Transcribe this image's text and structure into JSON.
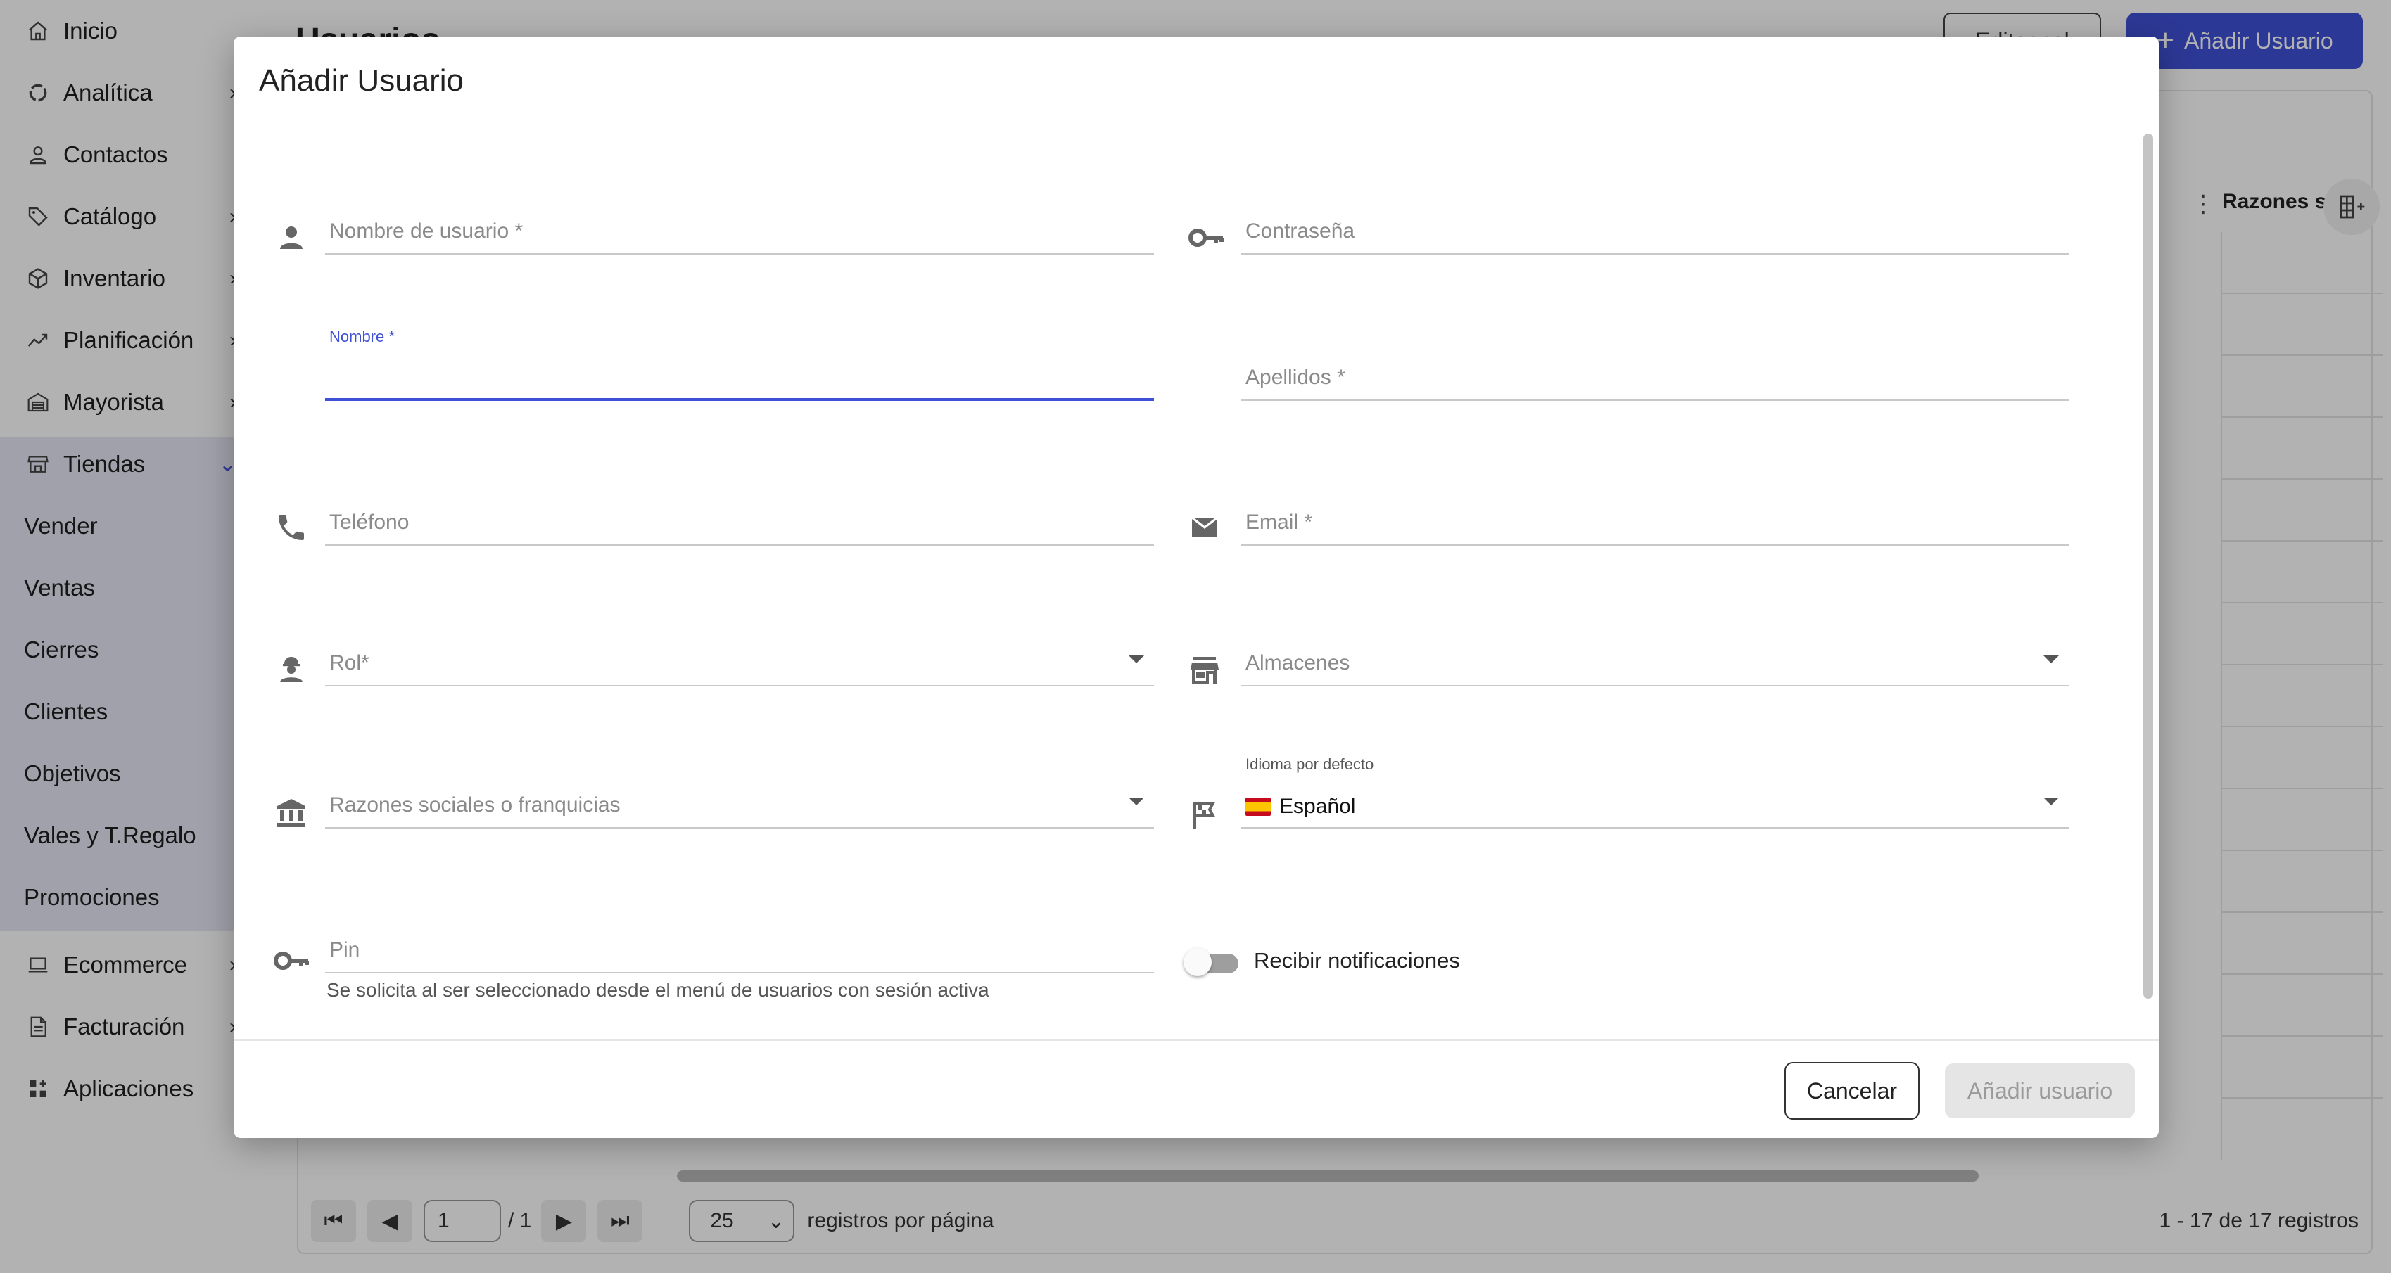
{
  "sidebar": {
    "items": [
      {
        "label": "Inicio",
        "icon": "home-icon",
        "chevron": ""
      },
      {
        "label": "Analítica",
        "icon": "analytics-icon",
        "chevron": "›"
      },
      {
        "label": "Contactos",
        "icon": "person-icon",
        "chevron": ""
      },
      {
        "label": "Catálogo",
        "icon": "tag-icon",
        "chevron": "›"
      },
      {
        "label": "Inventario",
        "icon": "box-icon",
        "chevron": "›"
      },
      {
        "label": "Planificación",
        "icon": "trend-icon",
        "chevron": "›"
      },
      {
        "label": "Mayorista",
        "icon": "warehouse-icon",
        "chevron": "›"
      },
      {
        "label": "Tiendas",
        "icon": "store-icon",
        "chevron": "⌄"
      }
    ],
    "tiendas_sub": [
      "Vender",
      "Ventas",
      "Cierres",
      "Clientes",
      "Objetivos",
      "Vales y T.Regalo",
      "Promociones"
    ],
    "bottom_items": [
      {
        "label": "Ecommerce",
        "icon": "laptop-icon",
        "chevron": "›"
      },
      {
        "label": "Facturación",
        "icon": "invoice-icon",
        "chevron": "›"
      },
      {
        "label": "Aplicaciones",
        "icon": "apps-icon",
        "chevron": ""
      }
    ]
  },
  "header": {
    "title": "Usuarios",
    "edit_label": "Editar col",
    "add_label": "Añadir Usuario"
  },
  "table": {
    "visible_column": "Razones s"
  },
  "pager": {
    "page_value": "1",
    "page_total": "/ 1",
    "per_page": "25",
    "per_page_label": "registros por página",
    "total": "1 - 17 de 17 registros"
  },
  "dialog": {
    "title": "Añadir Usuario",
    "fields": {
      "username": {
        "placeholder": "Nombre de usuario *",
        "icon": "person-icon"
      },
      "password": {
        "placeholder": "Contraseña",
        "icon": "key-icon"
      },
      "first_name": {
        "label": "Nombre *",
        "value": ""
      },
      "last_name": {
        "placeholder": "Apellidos *"
      },
      "phone": {
        "placeholder": "Teléfono",
        "icon": "phone-icon"
      },
      "email": {
        "placeholder": "Email *",
        "icon": "email-icon"
      },
      "role": {
        "placeholder": "Rol*",
        "icon": "worker-icon"
      },
      "warehouses": {
        "placeholder": "Almacenes",
        "icon": "store-icon"
      },
      "companies": {
        "placeholder": "Razones sociales o franquicias",
        "icon": "bank-icon"
      },
      "language": {
        "label": "Idioma por defecto",
        "value": "Español",
        "icon": "flag-icon"
      },
      "pin": {
        "placeholder": "Pin",
        "hint": "Se solicita al ser seleccionado desde el menú de usuarios con sesión activa",
        "icon": "key-icon"
      }
    },
    "notifications": {
      "label": "Recibir notificaciones",
      "enabled": false
    },
    "cancel_label": "Cancelar",
    "submit_label": "Añadir usuario"
  },
  "colors": {
    "accent": "#3f51d6",
    "sidebar_group_bg": "#e6e7f4",
    "disabled_bg": "#e5e5e5"
  }
}
